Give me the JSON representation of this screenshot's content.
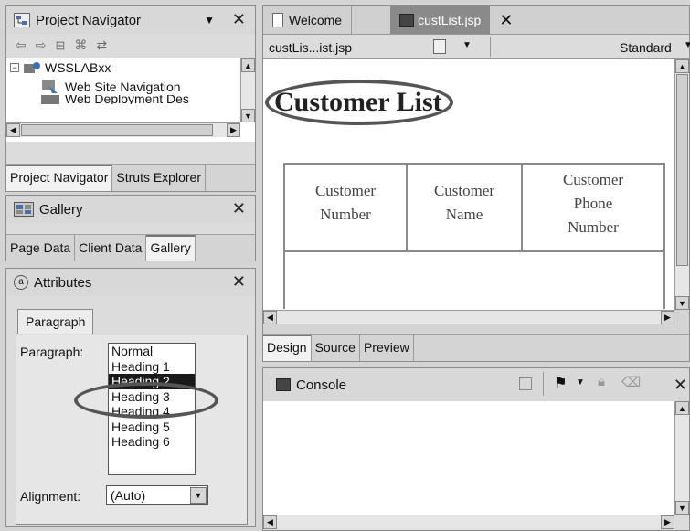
{
  "navigator": {
    "title": "Project Navigator",
    "tree": [
      "WSSLABxx",
      "Web Site Navigation",
      "Web Deployment Des"
    ],
    "tabs": [
      "Project Navigator",
      "Struts Explorer"
    ]
  },
  "gallery": {
    "title": "Gallery",
    "tabs": [
      "Page Data",
      "Client Data",
      "Gallery"
    ]
  },
  "attributes": {
    "title": "Attributes",
    "tab": "Paragraph",
    "paragraph_label": "Paragraph:",
    "paragraph_options": [
      "Normal",
      "Heading 1",
      "Heading 2",
      "Heading 3",
      "Heading 4",
      "Heading 5",
      "Heading 6"
    ],
    "selected": "Heading 2",
    "alignment_label": "Alignment:",
    "alignment_value": "(Auto)"
  },
  "editor": {
    "tabs": [
      "Welcome",
      "custList.jsp"
    ],
    "breadcrumb": "custLis...ist.jsp",
    "mode": "Standard",
    "heading": "Customer List",
    "columns": [
      [
        "Customer",
        "Number"
      ],
      [
        "Customer",
        "Name"
      ],
      [
        "Customer",
        "Phone",
        "Number"
      ]
    ],
    "bottom_tabs": [
      "Design",
      "Source",
      "Preview"
    ]
  },
  "console": {
    "title": "Console"
  },
  "icons": [
    "navigator-icon",
    "back-icon",
    "forward-icon",
    "collapse-icon",
    "link-icon",
    "sync-icon",
    "project-icon",
    "gallery-icon",
    "attributes-icon",
    "jsp-icon",
    "console-icon"
  ]
}
